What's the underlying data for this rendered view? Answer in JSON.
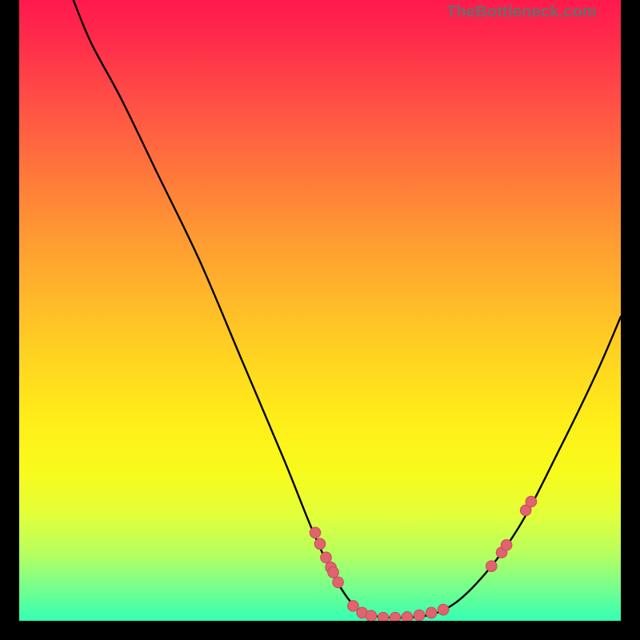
{
  "attribution": "TheBottleneck.com",
  "chart_data": {
    "type": "line",
    "title": "",
    "xlabel": "",
    "ylabel": "",
    "xlim": [
      0,
      100
    ],
    "ylim": [
      0,
      100
    ],
    "curve": {
      "name": "bottleneck-curve",
      "points": [
        {
          "x": 9.0,
          "y": 100.0
        },
        {
          "x": 12.0,
          "y": 93.0
        },
        {
          "x": 17.0,
          "y": 84.0
        },
        {
          "x": 23.0,
          "y": 72.0
        },
        {
          "x": 30.0,
          "y": 58.0
        },
        {
          "x": 37.0,
          "y": 42.0
        },
        {
          "x": 44.0,
          "y": 26.0
        },
        {
          "x": 49.0,
          "y": 14.0
        },
        {
          "x": 53.0,
          "y": 6.0
        },
        {
          "x": 57.0,
          "y": 1.5
        },
        {
          "x": 63.0,
          "y": 0.5
        },
        {
          "x": 70.0,
          "y": 1.5
        },
        {
          "x": 76.0,
          "y": 6.0
        },
        {
          "x": 83.0,
          "y": 15.0
        },
        {
          "x": 90.0,
          "y": 28.0
        },
        {
          "x": 96.0,
          "y": 40.0
        },
        {
          "x": 100.0,
          "y": 49.0
        }
      ]
    },
    "markers": [
      {
        "x": 49.2,
        "y": 14.2
      },
      {
        "x": 50.0,
        "y": 12.4
      },
      {
        "x": 51.0,
        "y": 10.2
      },
      {
        "x": 51.8,
        "y": 8.6
      },
      {
        "x": 52.2,
        "y": 7.8
      },
      {
        "x": 53.0,
        "y": 6.2
      },
      {
        "x": 55.5,
        "y": 2.4
      },
      {
        "x": 57.0,
        "y": 1.3
      },
      {
        "x": 58.5,
        "y": 0.8
      },
      {
        "x": 60.5,
        "y": 0.5
      },
      {
        "x": 62.5,
        "y": 0.5
      },
      {
        "x": 64.5,
        "y": 0.6
      },
      {
        "x": 66.5,
        "y": 0.9
      },
      {
        "x": 68.5,
        "y": 1.3
      },
      {
        "x": 70.5,
        "y": 1.8
      },
      {
        "x": 78.5,
        "y": 8.8
      },
      {
        "x": 80.2,
        "y": 11.0
      },
      {
        "x": 81.0,
        "y": 12.2
      },
      {
        "x": 84.2,
        "y": 17.8
      },
      {
        "x": 85.1,
        "y": 19.2
      }
    ],
    "gradient_stops": [
      {
        "pos": 0,
        "color": "#ff1a4d"
      },
      {
        "pos": 50,
        "color": "#ffc822"
      },
      {
        "pos": 100,
        "color": "#34ffb3"
      }
    ]
  }
}
